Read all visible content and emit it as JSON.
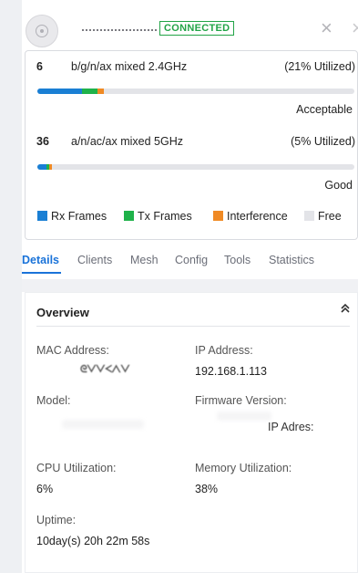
{
  "header": {
    "status_badge": "CONNECTED",
    "close_symbol": "×"
  },
  "radios": [
    {
      "channel": "6",
      "mode": "b/g/n/ax mixed  2.4GHz",
      "utilization": "(21% Utilized)",
      "quality": "Acceptable",
      "bar": {
        "rx": 0.14,
        "tx": 0.05,
        "interference": 0.02
      }
    },
    {
      "channel": "36",
      "mode": "a/n/ac/ax mixed  5GHz",
      "utilization": "(5% Utilized)",
      "quality": "Good",
      "bar": {
        "rx": 0.03,
        "tx": 0.01,
        "interference": 0.01
      }
    }
  ],
  "legend": {
    "rx": "Rx Frames",
    "tx": "Tx Frames",
    "interference": "Interference",
    "free": "Free"
  },
  "colors": {
    "rx": "#1a7fd4",
    "tx": "#1fb24a",
    "interference": "#f08a24",
    "free": "#e3e4e8",
    "accent": "#1a73d9",
    "connected": "#22a447"
  },
  "tabs": [
    "Details",
    "Clients",
    "Mesh",
    "Config",
    "Tools",
    "Statistics"
  ],
  "overview": {
    "title": "Overview",
    "collapse_icon": "double-chevron-up",
    "mac_label": "MAC Address:",
    "mac_value": "ᘓᐯᐯᐸᐱᐯ",
    "ip_label": "IP Address:",
    "ip_value": "192.168.1.113",
    "model_label": "Model:",
    "firmware_label": "Firmware Version:",
    "firmware_value": "IP Adres:",
    "cpu_label": "CPU Utilization:",
    "cpu_value": "6%",
    "memory_label": "Memory Utilization:",
    "memory_value": "38%",
    "uptime_label": "Uptime:",
    "uptime_value": "10day(s) 20h 22m 58s"
  }
}
